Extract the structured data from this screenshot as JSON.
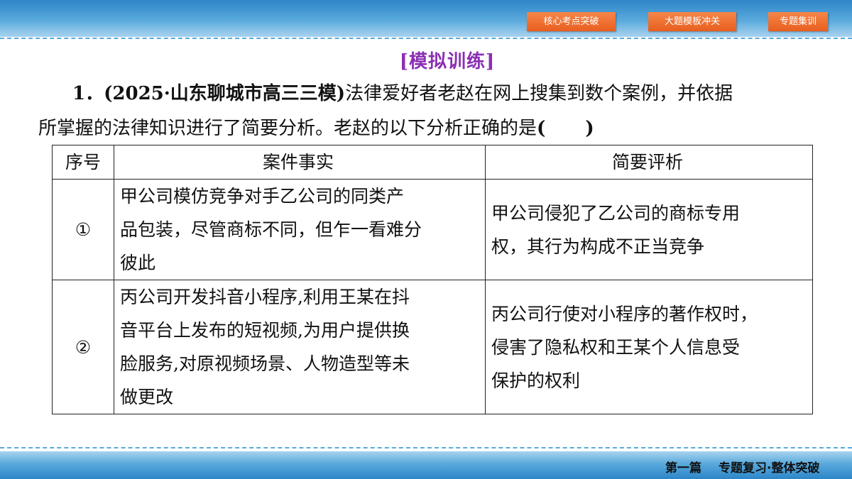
{
  "nav": {
    "buttons": [
      "核心考点突破",
      "大题模板冲关",
      "专题集训"
    ]
  },
  "section_title": "[模拟训练]",
  "question": {
    "line1_prefix": "1．(2025·山东聊城市高三三模)",
    "line1_rest": "法律爱好者老赵在网上搜集到数个案例，并依据",
    "line2_text": "所掌握的法律知识进行了简要分析。老赵的以下分析正确的是",
    "line2_open": "(",
    "line2_close": ")"
  },
  "table": {
    "headers": [
      "序号",
      "案件事实",
      "简要评析"
    ],
    "rows": [
      {
        "no": "①",
        "fact_lines": [
          "甲公司模仿竞争对手乙公司的同类产",
          "品包装，尽管商标不同，但乍一看难分",
          "彼此"
        ],
        "eval_lines": [
          "甲公司侵犯了乙公司的商标专用",
          "权，其行为构成不正当竞争"
        ]
      },
      {
        "no": "②",
        "fact_lines": [
          "丙公司开发抖音小程序,利用王某在抖",
          "音平台上发布的短视频,为用户提供换",
          "脸服务,对原视频场景、人物造型等未",
          "做更改"
        ],
        "eval_lines": [
          "丙公司行使对小程序的著作权时，",
          "侵害了隐私权和王某个人信息受",
          "保护的权利"
        ]
      }
    ]
  },
  "footer": {
    "part": "第一篇",
    "title": "专题复习·整体突破"
  },
  "colors": {
    "band_blue": "#3b92d1",
    "nav_orange": "#ee6d2c",
    "title_purple": "#8b2fb4"
  }
}
